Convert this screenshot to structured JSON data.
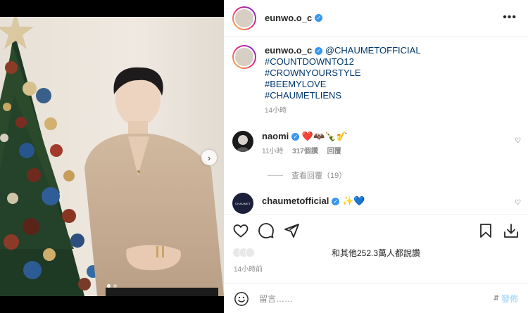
{
  "header": {
    "username": "eunwo.o_c",
    "more_icon": "more-horizontal-icon"
  },
  "caption": {
    "username": "eunwo.o_c",
    "mention": "@CHAUMETOFFICIAL",
    "hashtags": [
      "#COUNTDOWNTO12",
      "#CROWNYOURSTYLE",
      "#BEEMYLOVE",
      "#CHAUMETLIENS"
    ],
    "time": "14小時"
  },
  "comments": [
    {
      "username": "naomi",
      "emojis": "❤️🦇🍾🎷",
      "time": "11小時",
      "likes": "317個讚",
      "reply": "回覆"
    },
    {
      "username": "chaumetofficial",
      "emojis": "✨💙",
      "avatar_text": "CHAUMET"
    }
  ],
  "view_replies": "查看回覆（19）",
  "likes_text": "和其他252.3萬人都說讚",
  "post_time": "14小時前",
  "comment_input": {
    "placeholder": "留言……",
    "post_label": "發佈"
  },
  "colors": {
    "link": "#00376b",
    "verified": "#3897f0",
    "post_button": "#b2dffc"
  }
}
